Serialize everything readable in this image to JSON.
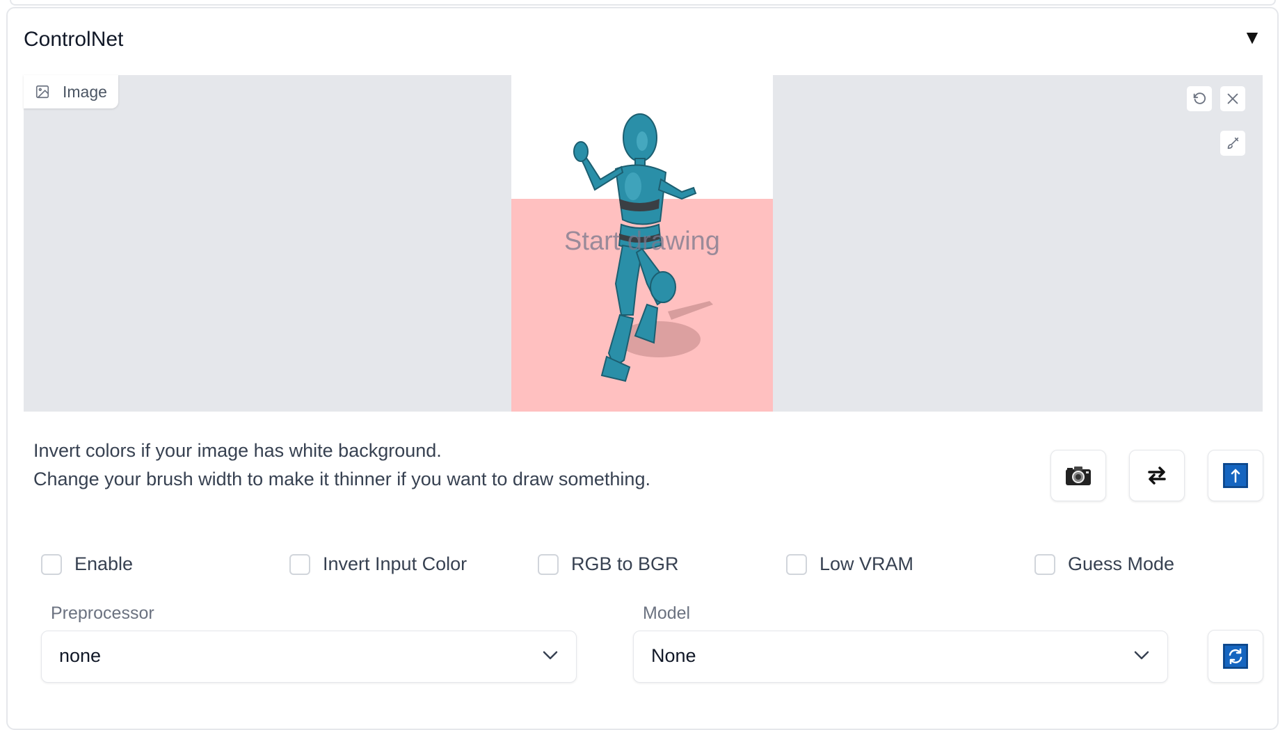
{
  "panel": {
    "title": "ControlNet",
    "collapse_glyph": "▼"
  },
  "image_input": {
    "label": "Image",
    "label_icon": "image-icon",
    "canvas_placeholder": "Start drawing",
    "tools": [
      "undo-icon",
      "close-icon",
      "brush-icon"
    ]
  },
  "hint": {
    "line1": "Invert colors if your image has white background.",
    "line2": "Change your brush width to make it thinner if you want to draw something."
  },
  "action_buttons": [
    "camera-icon",
    "swap-arrows-icon",
    "upload-icon"
  ],
  "checkboxes": [
    {
      "label": "Enable",
      "checked": false
    },
    {
      "label": "Invert Input Color",
      "checked": false
    },
    {
      "label": "RGB to BGR",
      "checked": false
    },
    {
      "label": "Low VRAM",
      "checked": false
    },
    {
      "label": "Guess Mode",
      "checked": false
    }
  ],
  "preprocessor": {
    "label": "Preprocessor",
    "value": "none"
  },
  "model": {
    "label": "Model",
    "value": "None"
  },
  "refresh_button": {
    "icon": "refresh-icon"
  },
  "colors": {
    "canvas_pink": "#ffc0c0",
    "figure_teal": "#2a8fa8",
    "accent_blue": "#1565c0"
  }
}
